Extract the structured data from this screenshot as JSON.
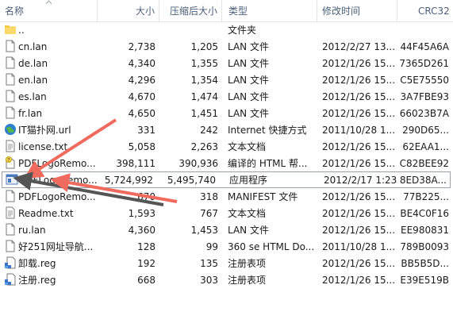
{
  "header": {
    "name": "名称",
    "size": "大小",
    "compressed": "压缩后大小",
    "type": "类型",
    "modified": "修改时间",
    "crc": "CRC32"
  },
  "files": [
    {
      "name": "..",
      "size": "",
      "csize": "",
      "type": "文件夹",
      "date": "",
      "crc": "",
      "icon": "folder-icon"
    },
    {
      "name": "cn.lan",
      "size": "2,738",
      "csize": "1,205",
      "type": "LAN 文件",
      "date": "2012/2/27 13...",
      "crc": "44F45A6A",
      "icon": "file-icon"
    },
    {
      "name": "de.lan",
      "size": "4,340",
      "csize": "1,355",
      "type": "LAN 文件",
      "date": "2012/1/26 15...",
      "crc": "7365D261",
      "icon": "file-icon"
    },
    {
      "name": "en.lan",
      "size": "4,296",
      "csize": "1,354",
      "type": "LAN 文件",
      "date": "2012/1/26 15...",
      "crc": "C5E75550",
      "icon": "file-icon"
    },
    {
      "name": "es.lan",
      "size": "4,670",
      "csize": "1,474",
      "type": "LAN 文件",
      "date": "2012/1/26 15...",
      "crc": "3A7FBE93",
      "icon": "file-icon"
    },
    {
      "name": "fr.lan",
      "size": "4,650",
      "csize": "1,451",
      "type": "LAN 文件",
      "date": "2012/1/26 15...",
      "crc": "66023B7A",
      "icon": "file-icon"
    },
    {
      "name": "IT猫扑网.url",
      "size": "331",
      "csize": "242",
      "type": "Internet 快捷方式",
      "date": "2011/10/28 1...",
      "crc": "290D65...",
      "icon": "globe-icon"
    },
    {
      "name": "license.txt",
      "size": "5,058",
      "csize": "2,263",
      "type": "文本文档",
      "date": "2012/1/26 15...",
      "crc": "62EAA1...",
      "icon": "text-file-icon"
    },
    {
      "name": "PDFLogoRemo...",
      "size": "398,111",
      "csize": "390,936",
      "type": "编译的 HTML 帮...",
      "date": "2012/1/26 15...",
      "crc": "C82BEE92",
      "icon": "help-file-icon"
    },
    {
      "name": "PDFLogoRemo...",
      "size": "5,724,992",
      "csize": "5,495,740",
      "type": "应用程序",
      "date": "2012/2/17 1:23",
      "crc": "8ED38A...",
      "icon": "app-icon"
    },
    {
      "name": "PDFLogoRemo...",
      "size": "670",
      "csize": "318",
      "type": "MANIFEST 文件",
      "date": "2012/1/26 15...",
      "crc": "77B225...",
      "icon": "file-icon"
    },
    {
      "name": "Readme.txt",
      "size": "1,593",
      "csize": "767",
      "type": "文本文档",
      "date": "2012/1/26 15...",
      "crc": "BE4C0F16",
      "icon": "text-file-icon"
    },
    {
      "name": "ru.lan",
      "size": "4,360",
      "csize": "1,453",
      "type": "LAN 文件",
      "date": "2012/1/26 15...",
      "crc": "EE980831",
      "icon": "file-icon"
    },
    {
      "name": "好251网址导航...",
      "size": "128",
      "csize": "99",
      "type": "360 se HTML Do...",
      "date": "2011/10/28 1...",
      "crc": "789B0093",
      "icon": "file-icon"
    },
    {
      "name": "卸载.reg",
      "size": "192",
      "csize": "135",
      "type": "注册表项",
      "date": "2012/1/26 15...",
      "crc": "BB5B5D...",
      "icon": "registry-icon"
    },
    {
      "name": "注册.reg",
      "size": "668",
      "csize": "303",
      "type": "注册表项",
      "date": "2012/1/26 15...",
      "crc": "E39E519B",
      "icon": "registry-icon"
    }
  ],
  "selected_index": 9,
  "colors": {
    "arrow": "#f06a5e",
    "arrow_dark": "#555555",
    "header_text": "#4c607a",
    "selection_border": "#99a2aa"
  }
}
